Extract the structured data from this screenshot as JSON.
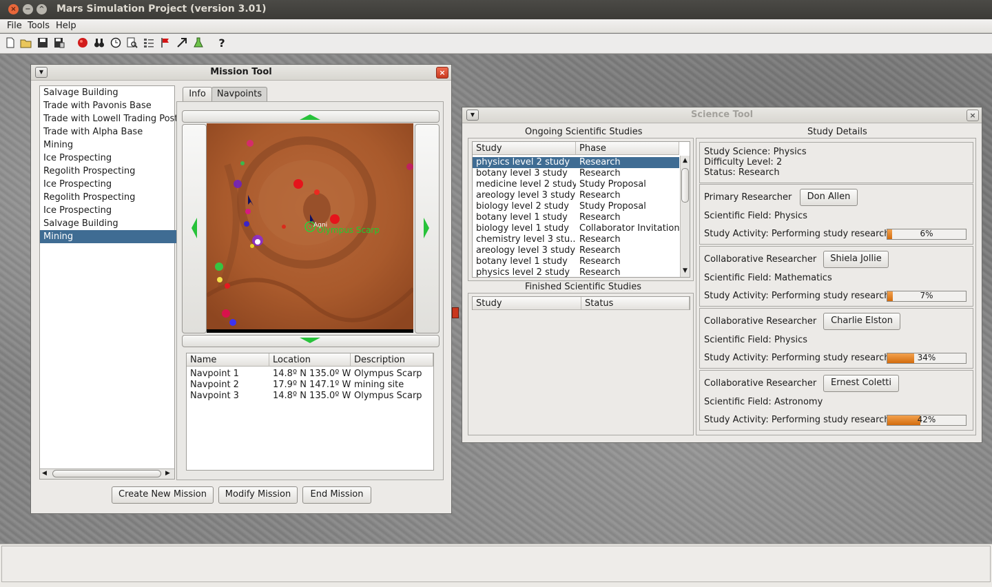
{
  "window": {
    "title": "Mars Simulation Project (version 3.01)"
  },
  "menu": [
    "File",
    "Tools",
    "Help"
  ],
  "toolbar": {
    "icons": [
      "new-icon",
      "open-icon",
      "save-icon",
      "save-as-icon",
      "mars-icon",
      "binoculars-icon",
      "clock-icon",
      "search-icon",
      "list-icon",
      "flag-icon",
      "navigation-icon",
      "flask-icon",
      "help-icon"
    ],
    "help_label": "?"
  },
  "mission_tool": {
    "title": "Mission Tool",
    "missions": [
      "Salvage Building",
      "Trade with Pavonis Base",
      "Trade with Lowell Trading Post",
      "Trade with Alpha Base",
      "Mining",
      "Ice Prospecting",
      "Regolith Prospecting",
      "Ice Prospecting",
      "Regolith Prospecting",
      "Ice Prospecting",
      "Salvage Building",
      "Mining"
    ],
    "selected_index": 11,
    "tabs": [
      "Info",
      "Navpoints"
    ],
    "active_tab": "Navpoints",
    "map": {
      "vehicle_label": "Agni",
      "location_label": "Olympus Scarp"
    },
    "navpoints": {
      "headers": [
        "Name",
        "Location",
        "Description"
      ],
      "rows": [
        [
          "Navpoint 1",
          "14.8º N 135.0º W",
          "Olympus Scarp"
        ],
        [
          "Navpoint 2",
          "17.9º N 147.1º W",
          "mining site"
        ],
        [
          "Navpoint 3",
          "14.8º N 135.0º W",
          "Olympus Scarp"
        ]
      ]
    },
    "buttons": {
      "create": "Create New Mission",
      "modify": "Modify Mission",
      "end": "End Mission"
    }
  },
  "science_tool": {
    "title": "Science Tool",
    "ongoing_title": "Ongoing Scientific Studies",
    "ongoing_headers": [
      "Study",
      "Phase"
    ],
    "ongoing_rows": [
      [
        "physics level 2 study",
        "Research"
      ],
      [
        "botany level 3 study",
        "Research"
      ],
      [
        "medicine level 2 study",
        "Study Proposal"
      ],
      [
        "areology level 3 study",
        "Research"
      ],
      [
        "biology level 2 study",
        "Study Proposal"
      ],
      [
        "botany level 1 study",
        "Research"
      ],
      [
        "biology level 1 study",
        "Collaborator Invitation"
      ],
      [
        "chemistry level 3 stu...",
        "Research"
      ],
      [
        "areology level 3 study",
        "Research"
      ],
      [
        "botany level 1 study",
        "Research"
      ],
      [
        "physics level 2 study",
        "Research"
      ]
    ],
    "finished_title": "Finished Scientific Studies",
    "finished_headers": [
      "Study",
      "Status"
    ],
    "details_title": "Study Details",
    "study_science": "Study Science: Physics",
    "difficulty": "Difficulty Level: 2",
    "status": "Status: Research",
    "researchers": [
      {
        "role": "Primary Researcher",
        "name": "Don Allen",
        "field": "Scientific Field: Physics",
        "activity": "Study Activity: Performing study research",
        "progress": 6,
        "progress_label": "6%"
      },
      {
        "role": "Collaborative Researcher",
        "name": "Shiela Jollie",
        "field": "Scientific Field: Mathematics",
        "activity": "Study Activity: Performing study research",
        "progress": 7,
        "progress_label": "7%"
      },
      {
        "role": "Collaborative Researcher",
        "name": "Charlie Elston",
        "field": "Scientific Field: Physics",
        "activity": "Study Activity: Performing study research",
        "progress": 34,
        "progress_label": "34%"
      },
      {
        "role": "Collaborative Researcher",
        "name": "Ernest Coletti",
        "field": "Scientific Field: Astronomy",
        "activity": "Study Activity: Performing study research",
        "progress": 42,
        "progress_label": "42%"
      }
    ]
  },
  "colors": {
    "selection": "#3f6c93",
    "progress": "#e07c1c",
    "close_button": "#d9462a"
  }
}
